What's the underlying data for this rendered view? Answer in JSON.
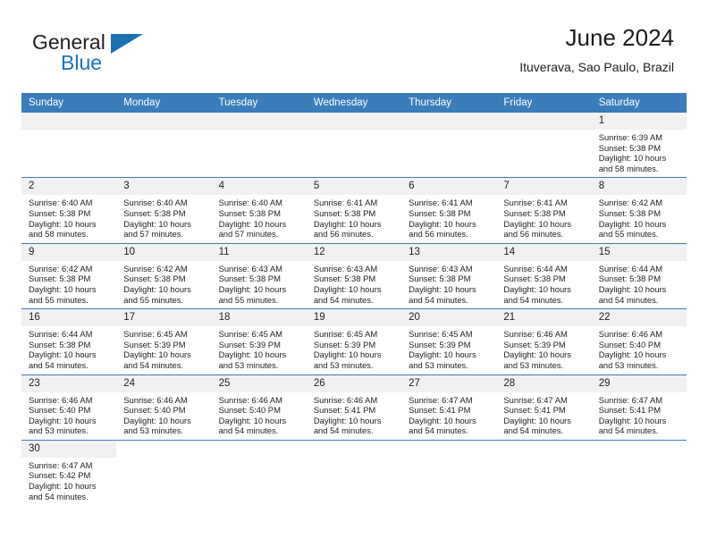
{
  "brand": {
    "word1": "General",
    "word2": "Blue",
    "flag_icon": "triangle-flag-icon",
    "accent_color": "#1b75bb"
  },
  "header": {
    "title": "June 2024",
    "subtitle": "Ituverava, Sao Paulo, Brazil"
  },
  "theme": {
    "header_row_bg": "#3b7cba",
    "daynum_bg": "#f1f1f1",
    "grid_line": "#3b7cba"
  },
  "weekday_headers": [
    "Sunday",
    "Monday",
    "Tuesday",
    "Wednesday",
    "Thursday",
    "Friday",
    "Saturday"
  ],
  "weeks": [
    [
      {
        "blank": true
      },
      {
        "blank": true
      },
      {
        "blank": true
      },
      {
        "blank": true
      },
      {
        "blank": true
      },
      {
        "blank": true
      },
      {
        "day": "1",
        "sunrise": "Sunrise: 6:39 AM",
        "sunset": "Sunset: 5:38 PM",
        "daylight1": "Daylight: 10 hours",
        "daylight2": "and 58 minutes."
      }
    ],
    [
      {
        "day": "2",
        "sunrise": "Sunrise: 6:40 AM",
        "sunset": "Sunset: 5:38 PM",
        "daylight1": "Daylight: 10 hours",
        "daylight2": "and 58 minutes."
      },
      {
        "day": "3",
        "sunrise": "Sunrise: 6:40 AM",
        "sunset": "Sunset: 5:38 PM",
        "daylight1": "Daylight: 10 hours",
        "daylight2": "and 57 minutes."
      },
      {
        "day": "4",
        "sunrise": "Sunrise: 6:40 AM",
        "sunset": "Sunset: 5:38 PM",
        "daylight1": "Daylight: 10 hours",
        "daylight2": "and 57 minutes."
      },
      {
        "day": "5",
        "sunrise": "Sunrise: 6:41 AM",
        "sunset": "Sunset: 5:38 PM",
        "daylight1": "Daylight: 10 hours",
        "daylight2": "and 56 minutes."
      },
      {
        "day": "6",
        "sunrise": "Sunrise: 6:41 AM",
        "sunset": "Sunset: 5:38 PM",
        "daylight1": "Daylight: 10 hours",
        "daylight2": "and 56 minutes."
      },
      {
        "day": "7",
        "sunrise": "Sunrise: 6:41 AM",
        "sunset": "Sunset: 5:38 PM",
        "daylight1": "Daylight: 10 hours",
        "daylight2": "and 56 minutes."
      },
      {
        "day": "8",
        "sunrise": "Sunrise: 6:42 AM",
        "sunset": "Sunset: 5:38 PM",
        "daylight1": "Daylight: 10 hours",
        "daylight2": "and 55 minutes."
      }
    ],
    [
      {
        "day": "9",
        "sunrise": "Sunrise: 6:42 AM",
        "sunset": "Sunset: 5:38 PM",
        "daylight1": "Daylight: 10 hours",
        "daylight2": "and 55 minutes."
      },
      {
        "day": "10",
        "sunrise": "Sunrise: 6:42 AM",
        "sunset": "Sunset: 5:38 PM",
        "daylight1": "Daylight: 10 hours",
        "daylight2": "and 55 minutes."
      },
      {
        "day": "11",
        "sunrise": "Sunrise: 6:43 AM",
        "sunset": "Sunset: 5:38 PM",
        "daylight1": "Daylight: 10 hours",
        "daylight2": "and 55 minutes."
      },
      {
        "day": "12",
        "sunrise": "Sunrise: 6:43 AM",
        "sunset": "Sunset: 5:38 PM",
        "daylight1": "Daylight: 10 hours",
        "daylight2": "and 54 minutes."
      },
      {
        "day": "13",
        "sunrise": "Sunrise: 6:43 AM",
        "sunset": "Sunset: 5:38 PM",
        "daylight1": "Daylight: 10 hours",
        "daylight2": "and 54 minutes."
      },
      {
        "day": "14",
        "sunrise": "Sunrise: 6:44 AM",
        "sunset": "Sunset: 5:38 PM",
        "daylight1": "Daylight: 10 hours",
        "daylight2": "and 54 minutes."
      },
      {
        "day": "15",
        "sunrise": "Sunrise: 6:44 AM",
        "sunset": "Sunset: 5:38 PM",
        "daylight1": "Daylight: 10 hours",
        "daylight2": "and 54 minutes."
      }
    ],
    [
      {
        "day": "16",
        "sunrise": "Sunrise: 6:44 AM",
        "sunset": "Sunset: 5:38 PM",
        "daylight1": "Daylight: 10 hours",
        "daylight2": "and 54 minutes."
      },
      {
        "day": "17",
        "sunrise": "Sunrise: 6:45 AM",
        "sunset": "Sunset: 5:39 PM",
        "daylight1": "Daylight: 10 hours",
        "daylight2": "and 54 minutes."
      },
      {
        "day": "18",
        "sunrise": "Sunrise: 6:45 AM",
        "sunset": "Sunset: 5:39 PM",
        "daylight1": "Daylight: 10 hours",
        "daylight2": "and 53 minutes."
      },
      {
        "day": "19",
        "sunrise": "Sunrise: 6:45 AM",
        "sunset": "Sunset: 5:39 PM",
        "daylight1": "Daylight: 10 hours",
        "daylight2": "and 53 minutes."
      },
      {
        "day": "20",
        "sunrise": "Sunrise: 6:45 AM",
        "sunset": "Sunset: 5:39 PM",
        "daylight1": "Daylight: 10 hours",
        "daylight2": "and 53 minutes."
      },
      {
        "day": "21",
        "sunrise": "Sunrise: 6:46 AM",
        "sunset": "Sunset: 5:39 PM",
        "daylight1": "Daylight: 10 hours",
        "daylight2": "and 53 minutes."
      },
      {
        "day": "22",
        "sunrise": "Sunrise: 6:46 AM",
        "sunset": "Sunset: 5:40 PM",
        "daylight1": "Daylight: 10 hours",
        "daylight2": "and 53 minutes."
      }
    ],
    [
      {
        "day": "23",
        "sunrise": "Sunrise: 6:46 AM",
        "sunset": "Sunset: 5:40 PM",
        "daylight1": "Daylight: 10 hours",
        "daylight2": "and 53 minutes."
      },
      {
        "day": "24",
        "sunrise": "Sunrise: 6:46 AM",
        "sunset": "Sunset: 5:40 PM",
        "daylight1": "Daylight: 10 hours",
        "daylight2": "and 53 minutes."
      },
      {
        "day": "25",
        "sunrise": "Sunrise: 6:46 AM",
        "sunset": "Sunset: 5:40 PM",
        "daylight1": "Daylight: 10 hours",
        "daylight2": "and 54 minutes."
      },
      {
        "day": "26",
        "sunrise": "Sunrise: 6:46 AM",
        "sunset": "Sunset: 5:41 PM",
        "daylight1": "Daylight: 10 hours",
        "daylight2": "and 54 minutes."
      },
      {
        "day": "27",
        "sunrise": "Sunrise: 6:47 AM",
        "sunset": "Sunset: 5:41 PM",
        "daylight1": "Daylight: 10 hours",
        "daylight2": "and 54 minutes."
      },
      {
        "day": "28",
        "sunrise": "Sunrise: 6:47 AM",
        "sunset": "Sunset: 5:41 PM",
        "daylight1": "Daylight: 10 hours",
        "daylight2": "and 54 minutes."
      },
      {
        "day": "29",
        "sunrise": "Sunrise: 6:47 AM",
        "sunset": "Sunset: 5:41 PM",
        "daylight1": "Daylight: 10 hours",
        "daylight2": "and 54 minutes."
      }
    ],
    [
      {
        "day": "30",
        "sunrise": "Sunrise: 6:47 AM",
        "sunset": "Sunset: 5:42 PM",
        "daylight1": "Daylight: 10 hours",
        "daylight2": "and 54 minutes."
      },
      {
        "blank": true
      },
      {
        "blank": true
      },
      {
        "blank": true
      },
      {
        "blank": true
      },
      {
        "blank": true
      },
      {
        "blank": true
      }
    ]
  ]
}
